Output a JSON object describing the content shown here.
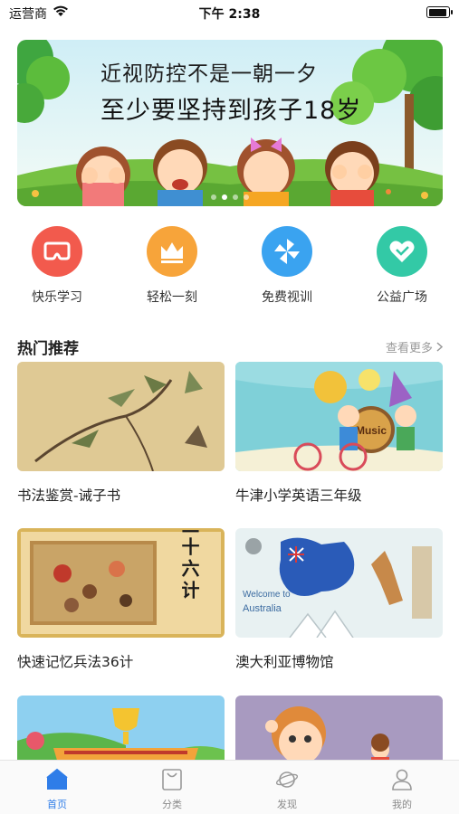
{
  "status_bar": {
    "carrier": "运营商",
    "time": "下午 2:38",
    "battery_level": 0.92
  },
  "banner": {
    "line1": "近视防控不是一朝一夕",
    "line2": "至少要坚持到孩子18岁",
    "page_count": 4,
    "active_page": 1
  },
  "quick_entries": [
    {
      "label": "快乐学习",
      "icon": "vr-glasses-icon",
      "color": "#f25a4d"
    },
    {
      "label": "轻松一刻",
      "icon": "crown-icon",
      "color": "#f7a43a"
    },
    {
      "label": "免费视训",
      "icon": "pinwheel-icon",
      "color": "#3aa3f0"
    },
    {
      "label": "公益广场",
      "icon": "heart-icon",
      "color": "#33c9a6"
    }
  ],
  "section": {
    "title": "热门推荐",
    "more": "查看更多"
  },
  "cards": [
    {
      "title": "书法鉴赏-诫子书"
    },
    {
      "title": "牛津小学英语三年级",
      "image_text": "Music"
    },
    {
      "title": "快速记忆兵法36计",
      "image_text": "三十六计"
    },
    {
      "title": "澳大利亚博物馆",
      "image_text_1": "Welcome to",
      "image_text_2": "Australia"
    },
    {
      "title": ""
    },
    {
      "title": ""
    }
  ],
  "tabbar": {
    "active": "home",
    "tabs": [
      {
        "label": "首页",
        "icon": "home-icon"
      },
      {
        "label": "分类",
        "icon": "bag-icon"
      },
      {
        "label": "发现",
        "icon": "planet-icon"
      },
      {
        "label": "我的",
        "icon": "person-icon"
      }
    ]
  },
  "colors": {
    "accent": "#2f7de8",
    "muted": "#9a9a9a"
  }
}
